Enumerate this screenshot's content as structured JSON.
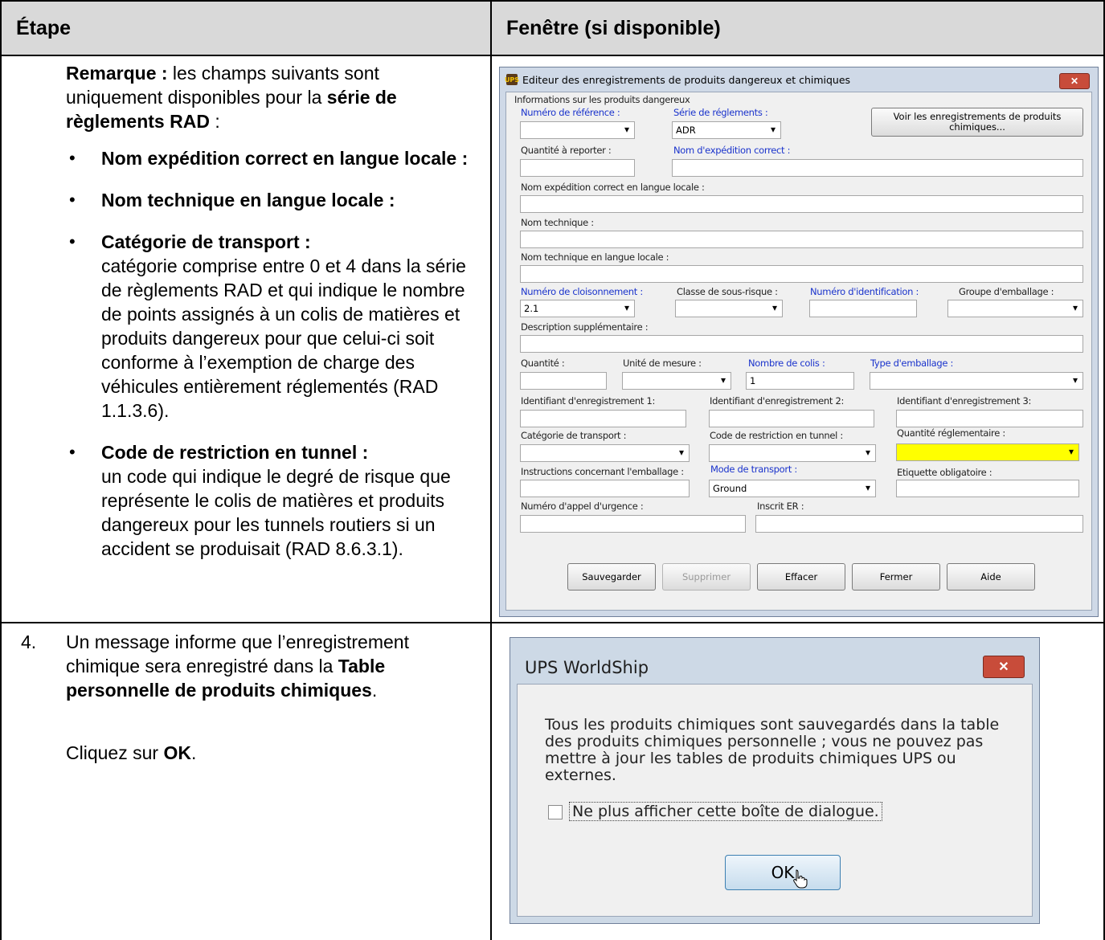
{
  "header": {
    "col1": "Étape",
    "col2": "Fenêtre (si disponible)"
  },
  "row1": {
    "remark_label": "Remarque :",
    "remark_text_1": " les champs suivants sont uniquement disponibles pour la ",
    "remark_bold": "série de règlements RAD",
    "remark_text_2": " :",
    "bullets": [
      {
        "bold": "Nom expédition correct en langue locale :",
        "text": ""
      },
      {
        "bold": "Nom technique en langue locale :",
        "text": ""
      },
      {
        "bold": "Catégorie de transport :",
        "text": "catégorie comprise entre 0 et 4 dans la série de règlements RAD et qui indique le nombre de points assignés à un colis de matières et produits dangereux pour que celui-ci soit conforme à l’exemption de charge des véhicules entièrement réglementés (RAD 1.1.3.6)."
      },
      {
        "bold": "Code de restriction en tunnel :",
        "text": "un code qui indique le degré de risque que représente le colis de matières et produits dangereux pour les tunnels routiers si un accident se produisait (RAD 8.6.3.1)."
      }
    ]
  },
  "row2": {
    "num": "4.",
    "text_1": "Un message informe que l’enregistrement chimique sera enregistré dans la ",
    "bold_1": "Table personnelle de produits chimiques",
    "text_2": ".",
    "click_prefix": "Cliquez sur ",
    "click_bold": "OK",
    "click_suffix": "."
  },
  "editor": {
    "title": "Editeur des enregistrements de produits dangereux et chimiques",
    "logo": "UPS",
    "close": "✕",
    "section": "Informations sur les produits dangereux",
    "labels": {
      "ref": "Numéro de référence :",
      "serie": "Série de réglements :",
      "qty_report": "Quantité à reporter :",
      "nom_exp": "Nom d'expédition correct :",
      "nom_exp_local": "Nom expédition correct en langue locale :",
      "nom_tech": "Nom technique :",
      "nom_tech_local": "Nom technique en langue locale :",
      "cloison": "Numéro de cloisonnement :",
      "sous_risque": "Classe de sous-risque :",
      "ident": "Numéro d'identification :",
      "groupe": "Groupe d'emballage :",
      "desc": "Description supplémentaire :",
      "quantite": "Quantité :",
      "unite": "Unité de mesure :",
      "nb_colis": "Nombre de colis :",
      "type_emb": "Type d'emballage :",
      "id1": "Identifiant d'enregistrement 1:",
      "id2": "Identifiant d'enregistrement 2:",
      "id3": "Identifiant d'enregistrement 3:",
      "cat_transport": "Catégorie de transport :",
      "tunnel": "Code de restriction en tunnel :",
      "qte_regl": "Quantité réglementaire :",
      "instructions": "Instructions concernant l'emballage :",
      "mode": "Mode de transport :",
      "etiquette": "Etiquette obligatoire :",
      "urgence": "Numéro d'appel d'urgence :",
      "inscrit": "Inscrit ER :"
    },
    "values": {
      "serie": "ADR",
      "cloison": "2.1",
      "nb_colis": "1",
      "mode": "Ground"
    },
    "voir_button": "Voir les enregistrements de produits chimiques...",
    "buttons": {
      "save": "Sauvegarder",
      "delete": "Supprimer",
      "clear": "Effacer",
      "close": "Fermer",
      "help": "Aide"
    }
  },
  "dialog": {
    "title": "UPS WorldShip",
    "close": "✕",
    "message": "Tous les produits chimiques sont sauvegardés dans la table des produits chimiques personnelle ; vous ne pouvez pas mettre à jour les tables de produits chimiques UPS ou externes.",
    "checkbox_label": "Ne plus afficher cette boîte de dialogue.",
    "ok": "OK"
  }
}
